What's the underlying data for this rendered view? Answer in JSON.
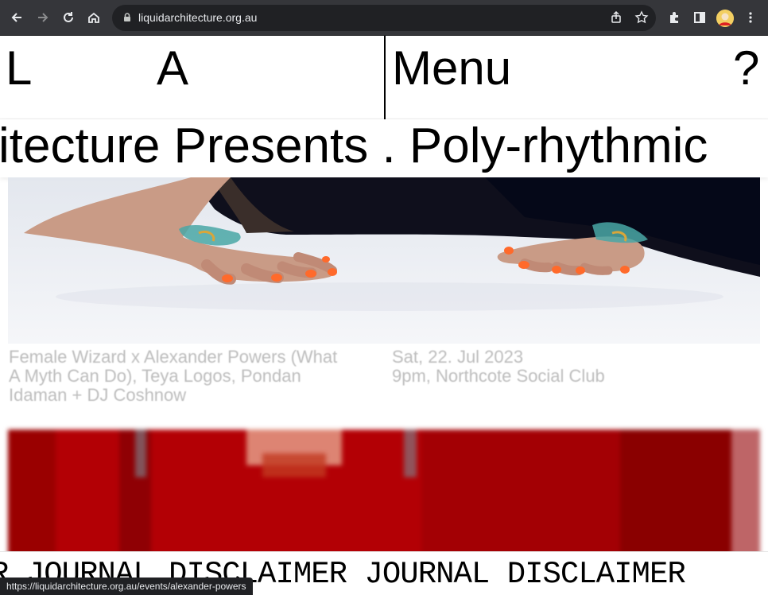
{
  "browser": {
    "url": "liquidarchitecture.org.au",
    "status_url": "https://liquidarchitecture.org.au/events/alexander-powers",
    "icons": [
      "back-icon",
      "forward-icon",
      "reload-icon",
      "home-icon",
      "lock-icon",
      "share-icon",
      "star-icon",
      "extensions-icon",
      "sidepanel-icon",
      "profile-avatar",
      "kebab-menu-icon"
    ]
  },
  "header": {
    "logo_left": "L",
    "logo_right": "A",
    "menu_label": "Menu",
    "help_label": "?"
  },
  "ticker": {
    "text": "itecture Presents . Poly-rhythmic"
  },
  "event": {
    "title": "Female Wizard x Alexander Powers (What A Myth Can Do), Teya Logos, Pondan Idaman + DJ Coshnow",
    "date": "Sat, 22. Jul 2023",
    "venue": "9pm, Northcote Social Club"
  },
  "footer": {
    "marquee_text": "R JOURNAL DISCLAIMER JOURNAL DISCLAIMER"
  },
  "colors": {
    "chrome": "#35363a",
    "omnibox": "#202124",
    "event_text": "#bdbdbd",
    "red_card": "#b30005",
    "nail_orange": "#ff6a2b"
  }
}
